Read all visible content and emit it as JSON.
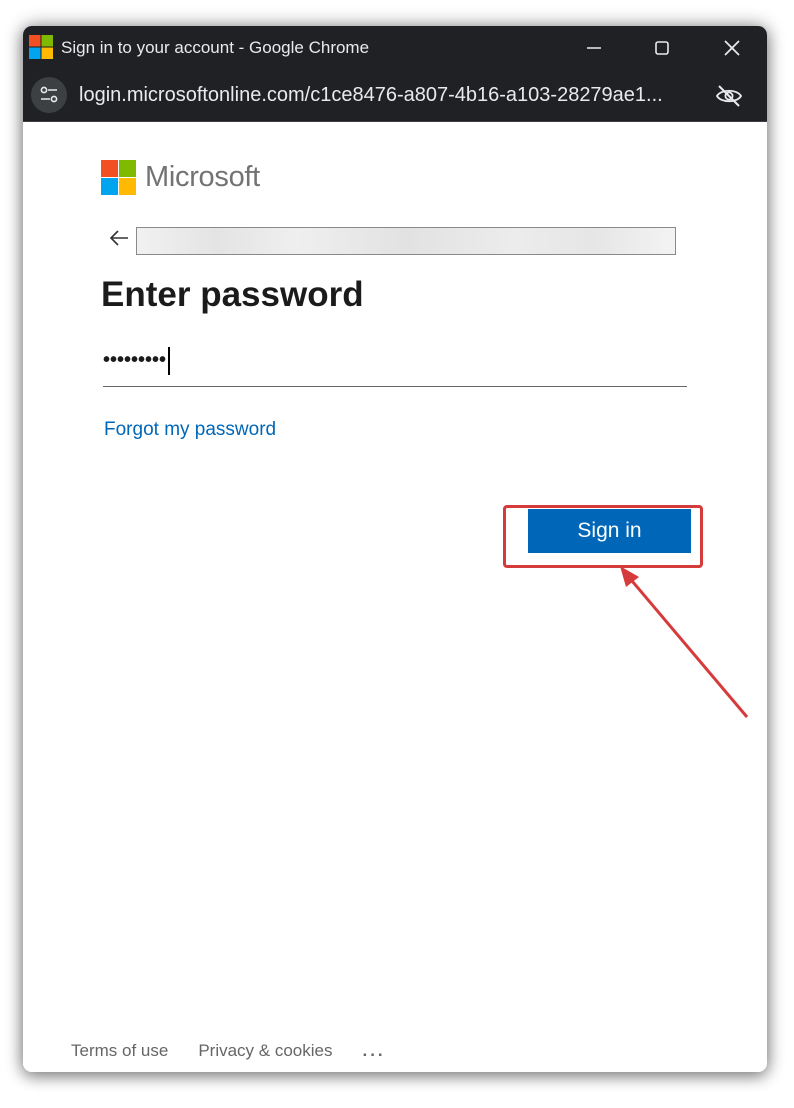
{
  "window": {
    "title": "Sign in to your account - Google Chrome"
  },
  "urlbar": {
    "url": "login.microsoftonline.com/c1ce8476-a807-4b16-a103-28279ae1..."
  },
  "brand": {
    "name": "Microsoft",
    "colors": [
      "#f25022",
      "#7fba00",
      "#00a4ef",
      "#ffb900"
    ]
  },
  "form": {
    "heading": "Enter password",
    "password_masked": "•••••••••",
    "forgot_link": "Forgot my password",
    "signin_label": "Sign in"
  },
  "footer": {
    "terms": "Terms of use",
    "privacy": "Privacy & cookies",
    "more": "..."
  },
  "colors": {
    "accent": "#0067b8",
    "annotation": "#d63b3b",
    "titlebar": "#202124"
  },
  "icons": [
    "chrome-logo-icon",
    "minimize-icon",
    "maximize-icon",
    "close-icon",
    "site-settings-icon",
    "eye-off-icon",
    "back-arrow-icon"
  ]
}
